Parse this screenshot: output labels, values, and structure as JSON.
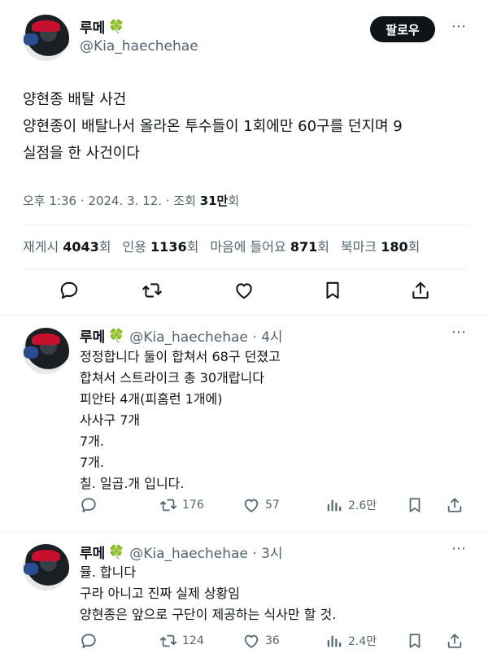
{
  "main_tweet": {
    "name": "루메",
    "name_emoji": "🍀",
    "handle": "@Kia_haechehae",
    "follow_label": "팔로우",
    "lines": [
      "양현종 배탈 사건",
      "양현종이 배탈나서 올라온 투수들이 1회에만 60구를 던지며 9",
      "실점을 한 사건이다"
    ],
    "timestamp": "오후 1:36 · 2024. 3. 12. · 조회 ",
    "views": "31만",
    "views_suffix": "회",
    "stats": {
      "retweets_label": "재게시 ",
      "retweets": "4043",
      "retweets_unit": "회",
      "quotes_label": "인용 ",
      "quotes": "1136",
      "quotes_unit": "회",
      "likes_label": "마음에 들어요 ",
      "likes": "871",
      "likes_unit": "회",
      "bookmarks_label": "북마크 ",
      "bookmarks": "180",
      "bookmarks_unit": "회"
    }
  },
  "replies": [
    {
      "name": "루메",
      "name_emoji": "🍀",
      "handle_time": "@Kia_haechehae · 4시",
      "lines": [
        "정정합니다 둘이 합쳐서 68구 던졌고",
        "합쳐서 스트라이크 총 30개랍니다",
        "피안타 4개(피홈런 1개에)",
        "사사구 7개",
        "7개.",
        "7개.",
        "칠. 일곱.개 입니다."
      ],
      "retweets": "176",
      "likes": "57",
      "views": "2.6만"
    },
    {
      "name": "루메",
      "name_emoji": "🍀",
      "handle_time": "@Kia_haechehae · 3시",
      "lines": [
        "뮬. 합니다",
        "구라 아니고 진짜 실제 상황임",
        "양현종은 앞으로 구단이 제공하는 식사만 할 것."
      ],
      "retweets": "124",
      "likes": "36",
      "views": "2.4만"
    }
  ],
  "icons": [
    "reply-icon",
    "retweet-icon",
    "like-icon",
    "bookmark-icon",
    "share-icon",
    "views-icon"
  ],
  "colors": {
    "text": "#0f1419",
    "secondary": "#536471",
    "follow_bg": "#0f1419",
    "clover": "#3ba55d"
  }
}
